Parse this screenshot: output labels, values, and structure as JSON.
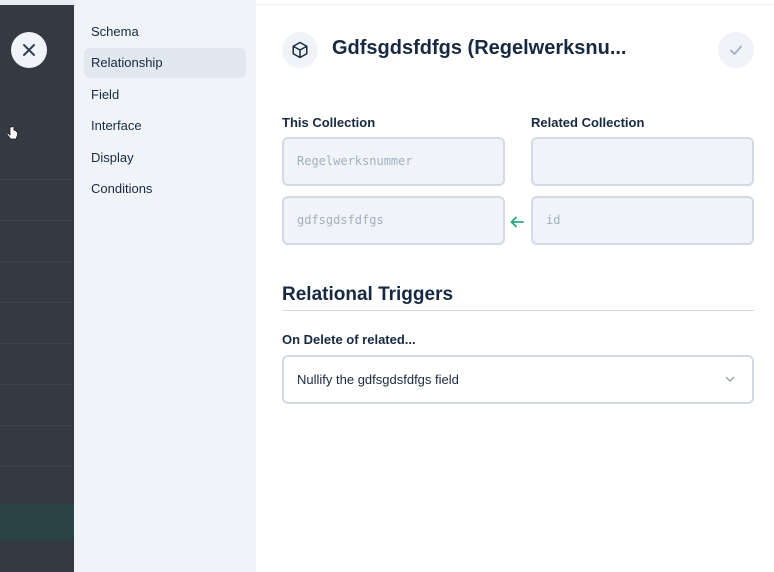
{
  "overlay": {
    "close_icon": "close-icon",
    "cursor_icon": "hand-pointer-icon"
  },
  "nav": {
    "items": [
      {
        "label": "Schema"
      },
      {
        "label": "Relationship",
        "active": true
      },
      {
        "label": "Field"
      },
      {
        "label": "Interface"
      },
      {
        "label": "Display"
      },
      {
        "label": "Conditions"
      }
    ]
  },
  "header": {
    "icon": "box-icon",
    "title": "Gdfsgdsfdfgs (Regelwerksnu...",
    "save_icon": "check-icon"
  },
  "relationship": {
    "this_collection_label": "This Collection",
    "related_collection_label": "Related Collection",
    "this_collection_value": "Regelwerksnummer",
    "related_collection_value": "",
    "this_field_value": "gdfsgdsfdfgs",
    "related_field_value": "id",
    "arrow_icon": "arrow-left-icon"
  },
  "triggers": {
    "title": "Relational Triggers",
    "on_delete_label": "On Delete of related...",
    "on_delete_value": "Nullify the gdfsgdsfdfgs field",
    "chevron_icon": "chevron-down-icon"
  },
  "colors": {
    "overlay": "#333a41",
    "nav_bg": "#f0f4f9",
    "accent": "#2ea77f",
    "text": "#172940",
    "muted": "#a2b0c0"
  }
}
